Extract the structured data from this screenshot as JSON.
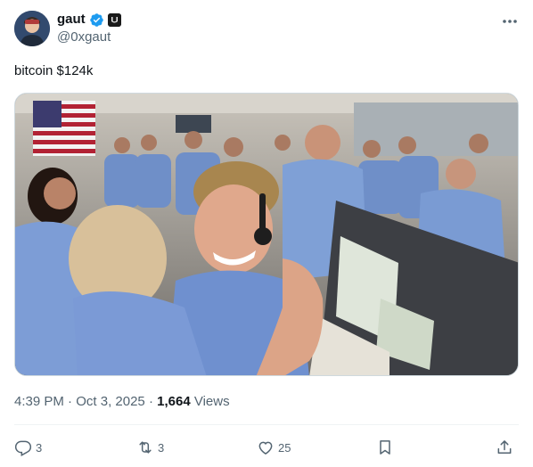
{
  "author": {
    "display_name": "gaut",
    "handle": "@0xgaut",
    "verified": true,
    "affiliation_badge": "dark-square-badge",
    "avatar": "avatar-image"
  },
  "tweet": {
    "text": "bitcoin $124k",
    "media": {
      "type": "photo",
      "description_icon": "mission-control-celebration-photo"
    }
  },
  "meta": {
    "time": "4:39 PM",
    "separator": "·",
    "date": "Oct 3, 2025",
    "views_count": "1,664",
    "views_label": "Views"
  },
  "actions": {
    "reply": {
      "icon": "reply-icon",
      "count": "3"
    },
    "repost": {
      "icon": "repost-icon",
      "count": "3"
    },
    "like": {
      "icon": "like-icon",
      "count": "25"
    },
    "bookmark": {
      "icon": "bookmark-icon"
    },
    "share": {
      "icon": "share-icon"
    }
  },
  "colors": {
    "text_primary": "#0f1419",
    "text_secondary": "#536471",
    "verified_blue": "#1d9bf0",
    "divider": "#eff3f4"
  }
}
